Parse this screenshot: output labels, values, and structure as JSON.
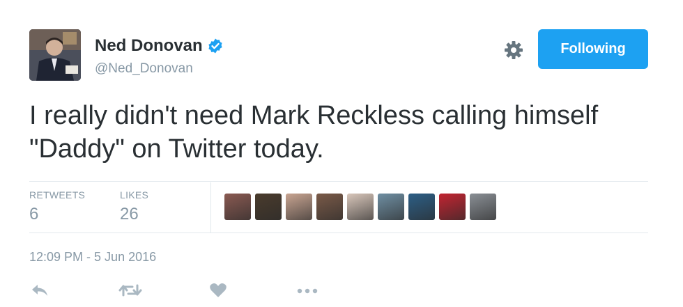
{
  "author": {
    "name": "Ned Donovan",
    "handle": "@Ned_Donovan",
    "verified_icon": "verified-badge-icon"
  },
  "follow_button": {
    "label": "Following"
  },
  "settings_icon": "gear-icon",
  "tweet": {
    "text": "I really didn't need Mark Reckless calling himself \"Daddy\" on Twitter today."
  },
  "stats": {
    "retweets_label": "RETWEETS",
    "retweets_value": "6",
    "likes_label": "LIKES",
    "likes_value": "26"
  },
  "liker_avatars": [
    {
      "name": "liker-avatar",
      "color": "#8a5a52"
    },
    {
      "name": "liker-avatar",
      "color": "#4a3b2c"
    },
    {
      "name": "liker-avatar",
      "color": "#c9a592"
    },
    {
      "name": "liker-avatar",
      "color": "#7a5a48"
    },
    {
      "name": "liker-avatar",
      "color": "#d9c7bb"
    },
    {
      "name": "liker-avatar",
      "color": "#6f8fa3"
    },
    {
      "name": "liker-avatar",
      "color": "#2d5f86"
    },
    {
      "name": "liker-avatar",
      "color": "#c22431"
    },
    {
      "name": "liker-avatar",
      "color": "#8a8f95"
    }
  ],
  "timestamp": "12:09 PM - 5 Jun 2016",
  "actions": [
    "reply-icon",
    "retweet-icon",
    "like-icon",
    "more-icon"
  ],
  "colors": {
    "accent": "#1da1f2",
    "text": "#292f33",
    "muted": "#8899a6",
    "divider": "#e1e8ed"
  }
}
